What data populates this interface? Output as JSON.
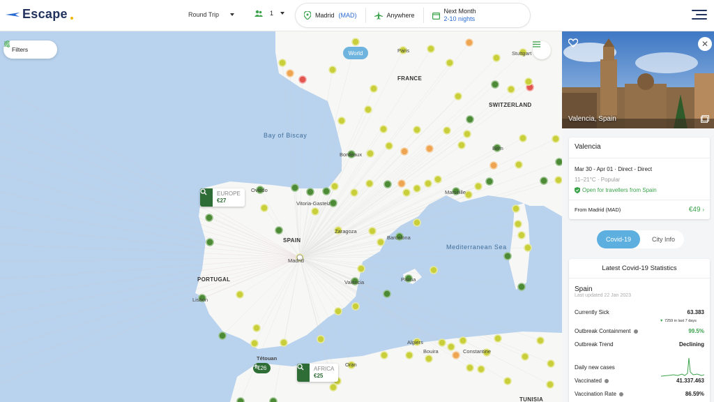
{
  "app": {
    "name": "Escape"
  },
  "header": {
    "trip_type": "Round Trip",
    "passengers": "1",
    "origin": "Madrid",
    "origin_code": "(MAD)",
    "destination": "Anywhere",
    "when_title": "Next Month",
    "when_nights": "2-10 nights"
  },
  "map": {
    "filters_label": "Filters",
    "world_label": "World",
    "countries": [
      "FRANCE",
      "SWITZERLAND",
      "SPAIN",
      "PORTUGAL",
      "TUNISIA"
    ],
    "seas": [
      "Bay of Biscay",
      "Mediterranean Sea"
    ],
    "cities": [
      "Paris",
      "Stuttgart",
      "Bordeaux",
      "Bern",
      "Marseille",
      "Oviedo",
      "Vitoria-Gasteiz",
      "Zaragoza",
      "Barcelona",
      "Madrid",
      "Valencia",
      "Palma",
      "Lisbon",
      "Algiers",
      "Constantine",
      "Bouira",
      "Oran",
      "Tétouan"
    ],
    "region_europe": {
      "name": "EUROPE",
      "price": "€27"
    },
    "region_africa": {
      "name": "AFRICA",
      "price": "€25"
    },
    "badge_price": "€26"
  },
  "panel": {
    "photo_caption": "Valencia, Spain",
    "city": "Valencia",
    "dates": "Mar 30 - Apr 01 · Direct - Direct",
    "weather": "11–21°C · Popular",
    "open_status": "Open for travellers from Spain",
    "from_label": "From Madrid (MAD)",
    "from_price": "€49",
    "tabs": [
      "Covid-19",
      "City Info"
    ],
    "stats": {
      "title": "Latest Covid-19 Statistics",
      "country": "Spain",
      "updated": "Last updated 22 Jan 2023",
      "rows": [
        {
          "label": "Currently Sick",
          "value": "63.383"
        },
        {
          "label": "Outbreak Containment",
          "value": "99.5%"
        },
        {
          "label": "Outbreak Trend",
          "value": "Declining"
        },
        {
          "label": "Daily new cases",
          "value": ""
        },
        {
          "label": "Vaccinated",
          "value": "41.337.463"
        },
        {
          "label": "Vaccination Rate",
          "value": "86.59%"
        }
      ],
      "weekly_change": "7259 in last 7 days"
    }
  },
  "colors": {
    "accent": "#5dafe0",
    "brand_navy": "#22325e",
    "green_dark": "#2e6d35",
    "green": "#3aa34a",
    "sea": "#b9d3ee",
    "land": "#f7f7f5"
  }
}
